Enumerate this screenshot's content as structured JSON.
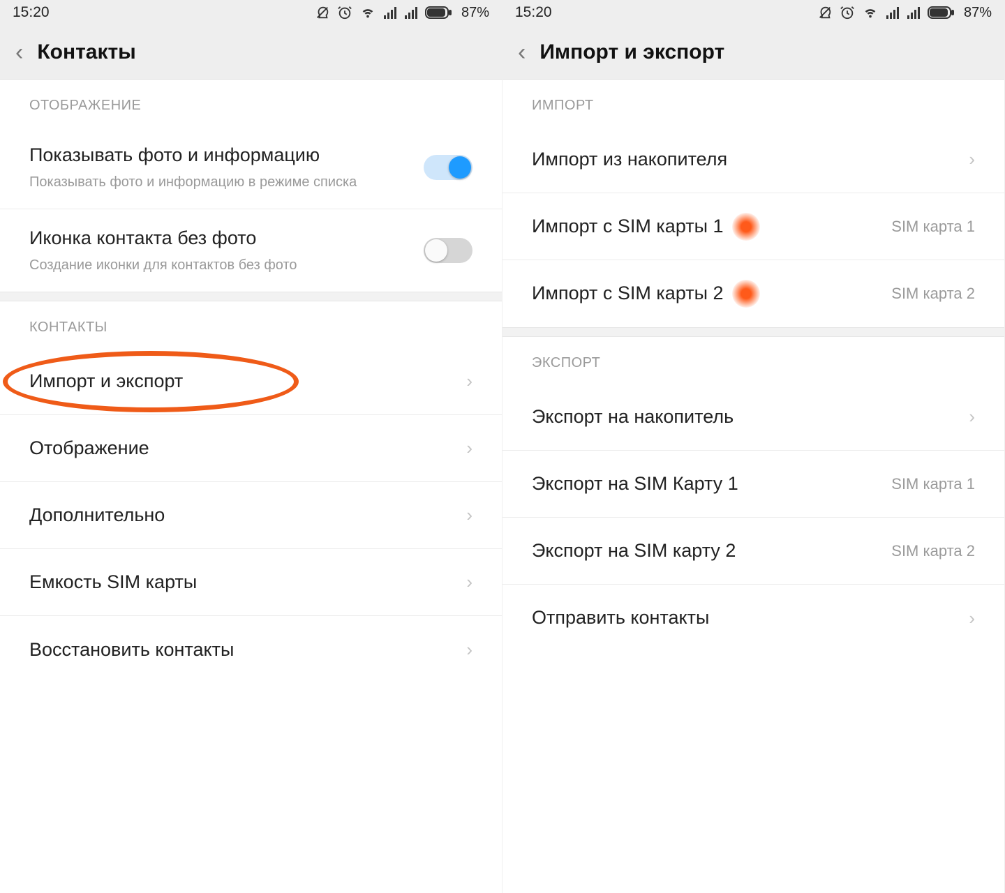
{
  "status": {
    "time": "15:20",
    "battery": "87%"
  },
  "left": {
    "title": "Контакты",
    "sections": {
      "display": "ОТОБРАЖЕНИЕ",
      "contacts": "КОНТАКТЫ"
    },
    "toggle1": {
      "label": "Показывать фото и информацию",
      "sub": "Показывать фото и информацию в режиме списка",
      "on": true
    },
    "toggle2": {
      "label": "Иконка контакта без фото",
      "sub": "Создание иконки для контактов без фото",
      "on": false
    },
    "rows": {
      "import_export": "Импорт и экспорт",
      "display": "Отображение",
      "advanced": "Дополнительно",
      "sim_capacity": "Емкость SIM карты",
      "restore": "Восстановить контакты"
    }
  },
  "right": {
    "title": "Импорт и экспорт",
    "sections": {
      "import": "ИМПОРТ",
      "export": "ЭКСПОРТ"
    },
    "rows": {
      "import_storage": "Импорт из накопителя",
      "import_sim1": {
        "label": "Импорт с SIM карты 1",
        "value": "SIM карта 1"
      },
      "import_sim2": {
        "label": "Импорт с SIM карты 2",
        "value": "SIM карта 2"
      },
      "export_storage": "Экспорт на накопитель",
      "export_sim1": {
        "label": "Экспорт на SIM Карту 1",
        "value": "SIM карта 1"
      },
      "export_sim2": {
        "label": "Экспорт на SIM карту 2",
        "value": "SIM карта 2"
      },
      "send": "Отправить контакты"
    }
  }
}
